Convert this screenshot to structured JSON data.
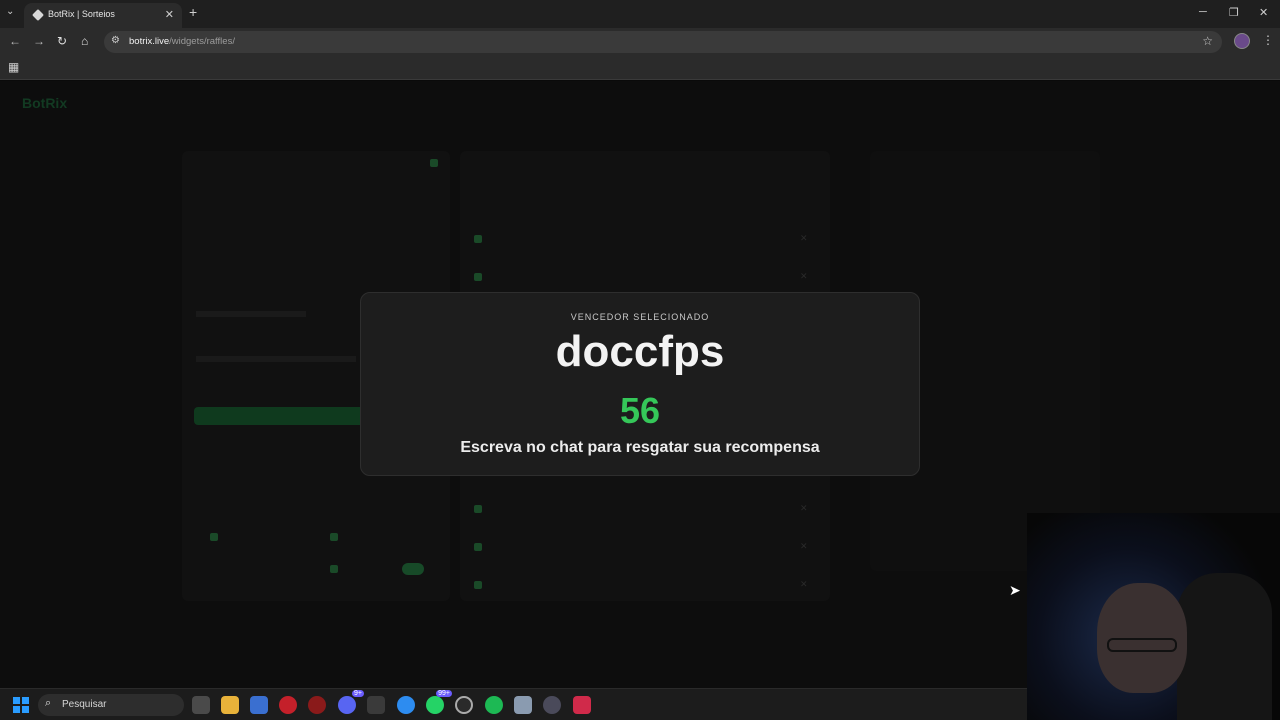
{
  "browser": {
    "tab_title": "BotRix | Sorteios",
    "url_host": "botrix.live",
    "url_path": "/widgets/raffles/"
  },
  "page": {
    "logo": "BotRix"
  },
  "winner_card": {
    "label": "VENCEDOR SELECIONADO",
    "winner_name": "doccfps",
    "number": "56",
    "message": "Escreva no chat para resgatar sua recompensa"
  },
  "taskbar": {
    "search_placeholder": "Pesquisar",
    "whatsapp_badge": "99+",
    "discord_badge": "9+"
  },
  "colors": {
    "accent_green": "#35c759",
    "card_bg": "#1d1d1d"
  }
}
